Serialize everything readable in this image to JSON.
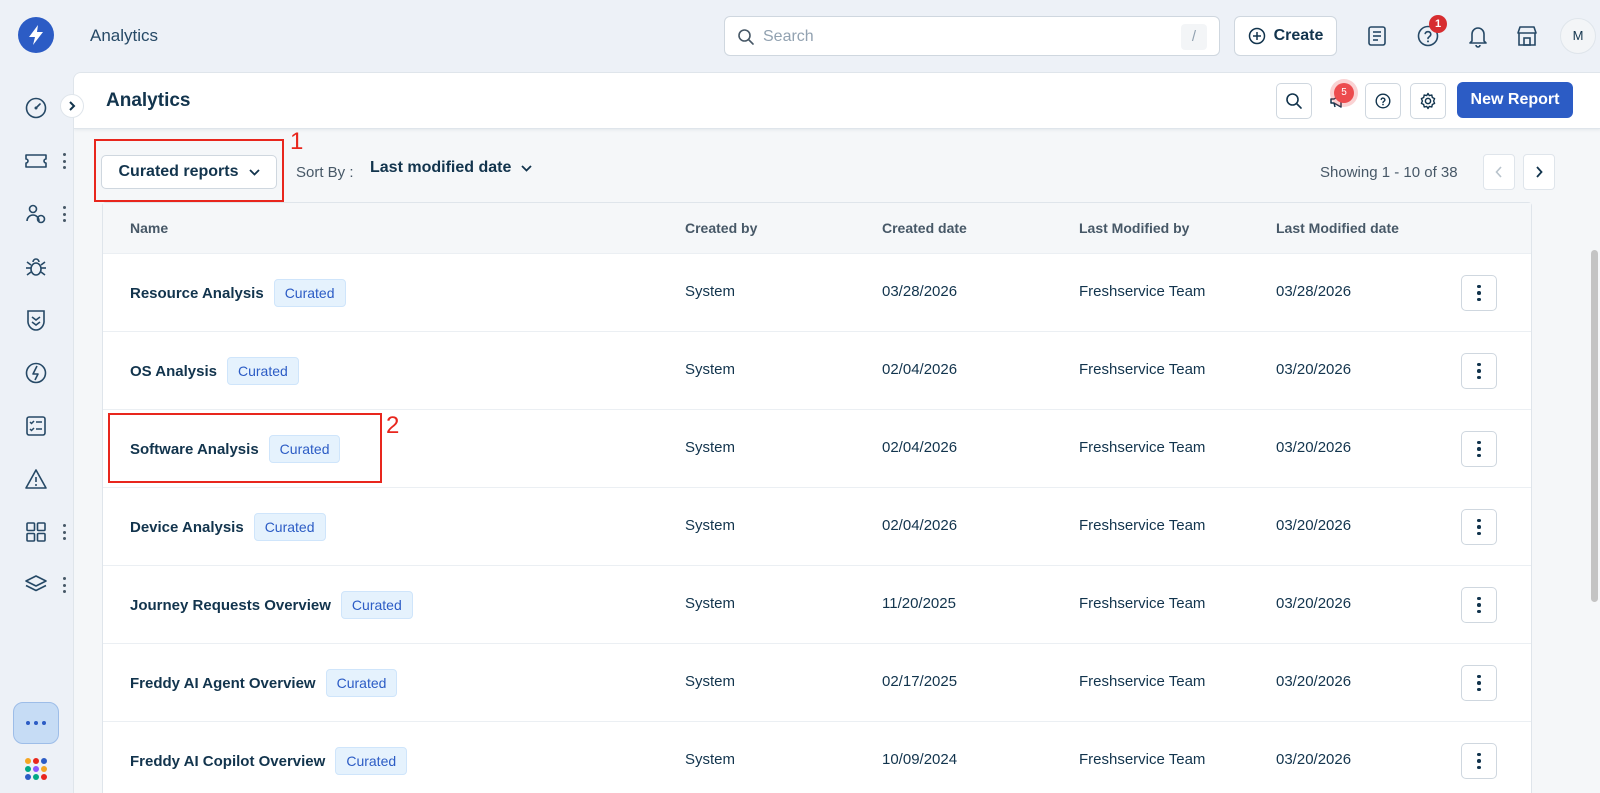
{
  "app": {
    "title": "Analytics"
  },
  "search": {
    "placeholder": "Search",
    "shortcut": "/"
  },
  "topbar": {
    "create_label": "Create",
    "help_badge": "1",
    "avatar_initial": "M"
  },
  "header": {
    "title": "Analytics",
    "announce_badge": "5",
    "new_report_label": "New Report"
  },
  "toolbar": {
    "filter_label": "Curated reports",
    "sort_by_label": "Sort By :",
    "sort_by_value": "Last modified date",
    "showing": "Showing 1 - 10 of 38"
  },
  "annotations": [
    "1",
    "2"
  ],
  "table": {
    "columns": [
      "Name",
      "Created by",
      "Created date",
      "Last Modified by",
      "Last Modified date"
    ],
    "rows": [
      {
        "name": "Resource Analysis",
        "tag": "Curated",
        "created_by": "System",
        "created_date": "03/28/2026",
        "modified_by": "Freshservice Team",
        "modified_date": "03/28/2026"
      },
      {
        "name": "OS Analysis",
        "tag": "Curated",
        "created_by": "System",
        "created_date": "02/04/2026",
        "modified_by": "Freshservice Team",
        "modified_date": "03/20/2026"
      },
      {
        "name": "Software Analysis",
        "tag": "Curated",
        "created_by": "System",
        "created_date": "02/04/2026",
        "modified_by": "Freshservice Team",
        "modified_date": "03/20/2026"
      },
      {
        "name": "Device Analysis",
        "tag": "Curated",
        "created_by": "System",
        "created_date": "02/04/2026",
        "modified_by": "Freshservice Team",
        "modified_date": "03/20/2026"
      },
      {
        "name": "Journey Requests Overview",
        "tag": "Curated",
        "created_by": "System",
        "created_date": "11/20/2025",
        "modified_by": "Freshservice Team",
        "modified_date": "03/20/2026"
      },
      {
        "name": "Freddy AI Agent Overview",
        "tag": "Curated",
        "created_by": "System",
        "created_date": "02/17/2025",
        "modified_by": "Freshservice Team",
        "modified_date": "03/20/2026"
      },
      {
        "name": "Freddy AI Copilot Overview",
        "tag": "Curated",
        "created_by": "System",
        "created_date": "10/09/2024",
        "modified_by": "Freshservice Team",
        "modified_date": "03/20/2026"
      }
    ]
  },
  "sidebar": {
    "items": [
      "dashboard-icon",
      "ticket-icon",
      "users-icon",
      "bug-icon",
      "shield-icon",
      "changes-icon",
      "tasks-icon",
      "alert-icon",
      "grid-icon",
      "layers-icon"
    ]
  },
  "colors": {
    "accent": "#2c5cc5",
    "annotation": "#e8261d",
    "tag_bg": "#e5f2fd"
  }
}
